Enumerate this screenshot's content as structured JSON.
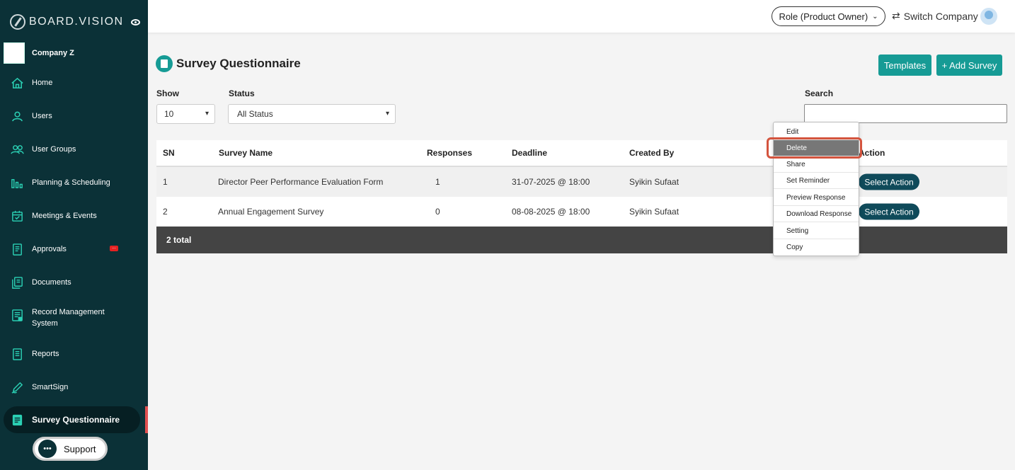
{
  "sidebar": {
    "brand": "BOARD.VISION",
    "company": "Company Z",
    "items": [
      {
        "label": "Home",
        "icon": "home-icon"
      },
      {
        "label": "Users",
        "icon": "user-icon"
      },
      {
        "label": "User Groups",
        "icon": "user-group-icon"
      },
      {
        "label": "Planning & Scheduling",
        "icon": "bar-chart-icon"
      },
      {
        "label": "Meetings & Events",
        "icon": "calendar-icon"
      },
      {
        "label": "Approvals",
        "icon": "approval-doc-icon",
        "badge": "..."
      },
      {
        "label": "Documents",
        "icon": "documents-icon"
      },
      {
        "label": "Record Management",
        "label2": "System",
        "icon": "record-icon"
      },
      {
        "label": "Reports",
        "icon": "report-icon"
      },
      {
        "label": "SmartSign",
        "icon": "pen-icon"
      },
      {
        "label": "Survey Questionnaire",
        "icon": "survey-icon"
      }
    ],
    "support": "Support"
  },
  "topbar": {
    "role": "Role (Product Owner)",
    "switch_company": "Switch Company"
  },
  "main": {
    "title": "Survey Questionnaire",
    "templates_btn": "Templates",
    "add_survey_btn": "+ Add Survey",
    "show_label": "Show",
    "show_value": "10",
    "status_label": "Status",
    "status_value": "All Status",
    "search_label": "Search"
  },
  "table": {
    "columns": [
      "SN",
      "Survey Name",
      "Responses",
      "Deadline",
      "Created By",
      "Action"
    ],
    "rows": [
      {
        "sn": "1",
        "name": "Director Peer Performance Evaluation Form",
        "responses": "1",
        "deadline": "31-07-2025 @ 18:00",
        "created_by": "Syikin Sufaat",
        "action": "Select Action"
      },
      {
        "sn": "2",
        "name": "Annual Engagement Survey",
        "responses": "0",
        "deadline": "08-08-2025 @ 18:00",
        "created_by": "Syikin Sufaat",
        "action": "Select Action"
      }
    ],
    "footer": "2 total"
  },
  "menu": {
    "items": [
      "Edit",
      "Delete",
      "Share",
      "Set Reminder",
      "Preview Response",
      "Download Response",
      "Setting",
      "Copy"
    ],
    "highlighted": "Delete"
  },
  "colors": {
    "sidebar_bg": "#0b3137",
    "accent": "#169b95",
    "action_btn": "#0f4a5a",
    "highlight_ring": "#d4543e"
  }
}
